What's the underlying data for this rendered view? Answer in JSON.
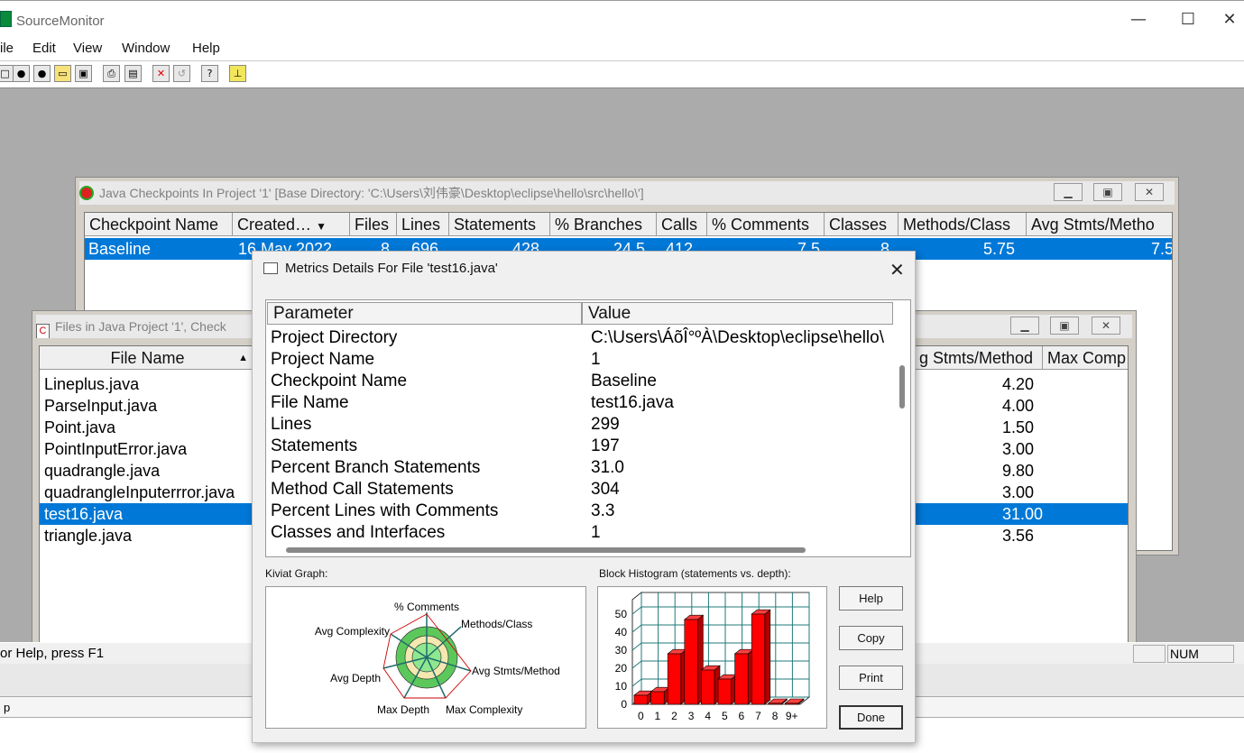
{
  "app": {
    "title": "SourceMonitor",
    "min": "—",
    "max": "☐",
    "close": "✕",
    "menus": [
      "ile",
      "Edit",
      "View",
      "Window",
      "Help"
    ],
    "toolbar_icons": [
      "new-icon",
      "gear-icon",
      "gear2-icon",
      "open-folder-icon",
      "save-icon",
      "print-icon",
      "print-preview-icon",
      "delete-icon",
      "refresh-icon",
      "help-cursor-icon",
      "pin-icon"
    ]
  },
  "checkpoints_window": {
    "title": "Java Checkpoints In Project '1'  [Base Directory: 'C:\\Users\\刘伟豪\\Desktop\\eclipse\\hello\\src\\hello\\']",
    "columns": [
      "Checkpoint Name",
      "Created…",
      "Files",
      "Lines",
      "Statements",
      "% Branches",
      "Calls",
      "% Comments",
      "Classes",
      "Methods/Class",
      "Avg Stmts/Metho"
    ],
    "row": [
      "Baseline",
      "16 May 2022",
      "8",
      "696",
      "428",
      "24.5",
      "412",
      "7.5",
      "8",
      "5.75",
      "7.5"
    ]
  },
  "files_window": {
    "title": "Files in Java Project '1', Check",
    "col_file": "File Name",
    "col_stmts": "g Stmts/Method",
    "col_maxc": "Max Comp",
    "files": [
      {
        "name": "Lineplus.java",
        "avg": "4.20"
      },
      {
        "name": "ParseInput.java",
        "avg": "4.00"
      },
      {
        "name": "Point.java",
        "avg": "1.50"
      },
      {
        "name": "PointInputError.java",
        "avg": "3.00"
      },
      {
        "name": "quadrangle.java",
        "avg": "9.80"
      },
      {
        "name": "quadrangleInputerrror.java",
        "avg": "3.00"
      },
      {
        "name": "test16.java",
        "avg": "31.00",
        "selected": true
      },
      {
        "name": "triangle.java",
        "avg": "3.56"
      }
    ]
  },
  "statusbar": {
    "help": "or Help, press F1",
    "num": "NUM",
    "bottom_text": "p"
  },
  "dialog": {
    "title": "Metrics Details For File 'test16.java'",
    "close": "✕",
    "col_param": "Parameter",
    "col_value": "Value",
    "rows": [
      {
        "param": "Project Directory",
        "value": "C:\\Users\\ÁõÎ°ºÀ\\Desktop\\eclipse\\hello\\"
      },
      {
        "param": "Project Name",
        "value": "1"
      },
      {
        "param": "Checkpoint Name",
        "value": "Baseline"
      },
      {
        "param": "File Name",
        "value": "test16.java"
      },
      {
        "param": "Lines",
        "value": "299"
      },
      {
        "param": "Statements",
        "value": "197"
      },
      {
        "param": "Percent Branch Statements",
        "value": "31.0"
      },
      {
        "param": "Method Call Statements",
        "value": "304"
      },
      {
        "param": "Percent Lines with Comments",
        "value": "3.3"
      },
      {
        "param": "Classes and Interfaces",
        "value": "1"
      }
    ],
    "kiviat_label": "Kiviat Graph:",
    "kiviat_axes": [
      "% Comments",
      "Methods/Class",
      "Avg Stmts/Method",
      "Max Complexity",
      "Max Depth",
      "Avg Depth",
      "Avg Complexity"
    ],
    "histogram_label": "Block Histogram (statements vs. depth):",
    "buttons": {
      "help": "Help",
      "copy": "Copy",
      "print": "Print",
      "done": "Done"
    }
  },
  "chart_data": {
    "type": "bar",
    "title": "Block Histogram (statements vs. depth):",
    "categories": [
      "0",
      "1",
      "2",
      "3",
      "4",
      "5",
      "6",
      "7",
      "8",
      "9+"
    ],
    "values": [
      5,
      7,
      28,
      47,
      19,
      14,
      28,
      50,
      0,
      0
    ],
    "ylim": [
      0,
      55
    ],
    "yticks": [
      0,
      10,
      20,
      30,
      40,
      50
    ],
    "grid": true,
    "bar_color": "#ff0000"
  },
  "colors": {
    "selection": "#0078d7",
    "kiviat_fill": "#8fe88f"
  }
}
